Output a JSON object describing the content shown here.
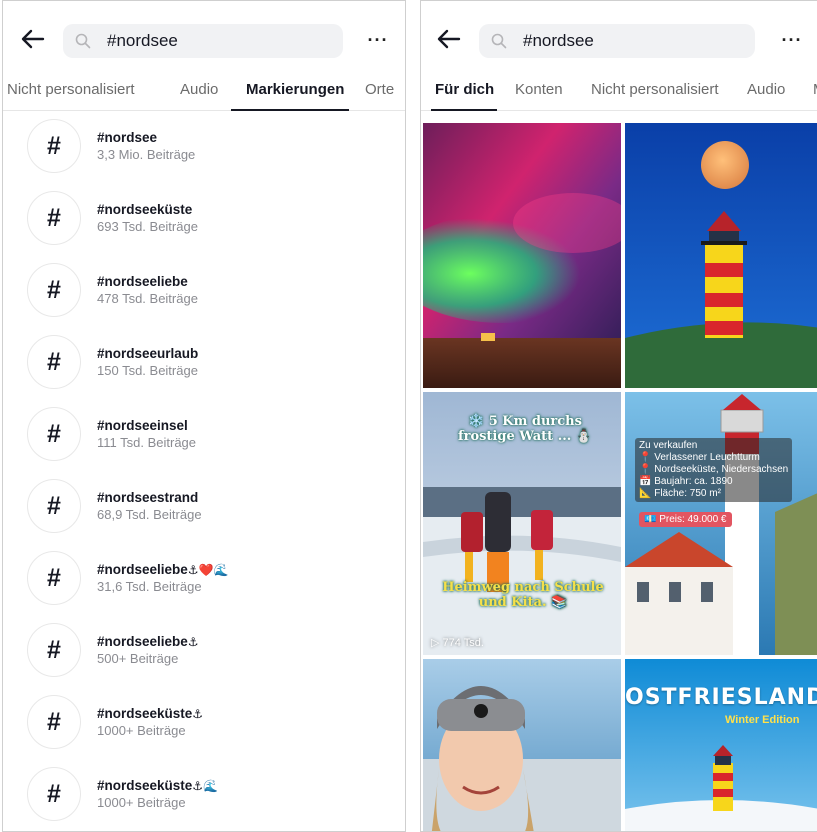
{
  "left": {
    "search_value": "#nordsee",
    "more_label": "···",
    "tabs": [
      "Nicht personalisiert",
      "Audio",
      "Markierungen",
      "Orte"
    ],
    "hashtags": [
      {
        "name": "#nordsee",
        "count": "3,3 Mio. Beiträge"
      },
      {
        "name": "#nordseeküste",
        "count": "693 Tsd. Beiträge"
      },
      {
        "name": "#nordseeliebe",
        "count": "478 Tsd. Beiträge"
      },
      {
        "name": "#nordseeurlaub",
        "count": "150 Tsd. Beiträge"
      },
      {
        "name": "#nordseeinsel",
        "count": "111 Tsd. Beiträge"
      },
      {
        "name": "#nordseestrand",
        "count": "68,9 Tsd. Beiträge"
      },
      {
        "name": "#nordseeliebe",
        "emoji": "⚓❤️🌊",
        "count": "31,6 Tsd. Beiträge"
      },
      {
        "name": "#nordseeliebe",
        "emoji": "⚓",
        "count": "500+ Beiträge"
      },
      {
        "name": "#nordseeküste",
        "emoji": "⚓",
        "count": "1000+ Beiträge"
      },
      {
        "name": "#nordseeküste",
        "emoji": "⚓🌊",
        "count": "1000+ Beiträge"
      }
    ]
  },
  "right": {
    "search_value": "#nordsee",
    "more_label": "···",
    "tabs": [
      "Für dich",
      "Konten",
      "Nicht personalisiert",
      "Audio",
      "M"
    ],
    "tiles": {
      "watt_title": "❄️ 5 Km durchs frostige Watt ... ⛄",
      "watt_bottom": "Heimweg nach Schule und Kita. 📚",
      "watt_views": "▷ 774 Tsd.",
      "sale_lines": [
        "Zu verkaufen",
        "📍 Verlassener Leuchtturm",
        "📍 Nordseeküste, Niedersachsen",
        "📅 Baujahr: ca. 1890",
        "📐 Fläche: 750 m²"
      ],
      "sale_price": "💶 Preis: 49.000 €",
      "ostfriesland_title": "OSTFRIESLAND",
      "ostfriesland_sub": "Winter Edition"
    }
  },
  "colors": {
    "accent_text": "#161823",
    "muted_text": "#8a8b91",
    "search_bg": "#f1f2f4"
  }
}
